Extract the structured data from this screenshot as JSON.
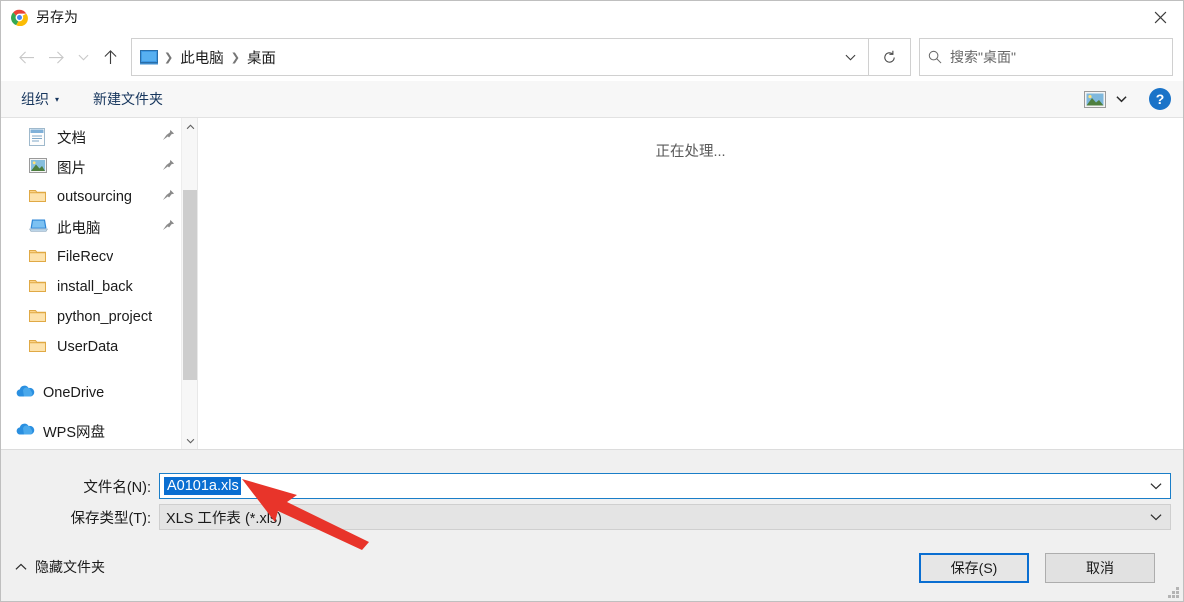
{
  "window": {
    "title": "另存为",
    "app_icon": "chrome-logo-icon",
    "close_label": "✕"
  },
  "nav": {
    "back_icon": "arrow-left-icon",
    "forward_icon": "arrow-right-icon",
    "recent_icon": "chevron-down-icon",
    "up_icon": "arrow-up-icon",
    "breadcrumb": {
      "root_icon": "monitor-icon",
      "items": [
        "此电脑",
        "桌面"
      ],
      "separator": "❯",
      "dropdown_icon": "chevron-down-icon"
    },
    "refresh_icon": "refresh-icon",
    "search": {
      "icon": "search-icon",
      "placeholder": "搜索\"桌面\"",
      "value": ""
    }
  },
  "commandbar": {
    "organize_label": "组织",
    "organize_caret": "▾",
    "new_folder_label": "新建文件夹",
    "view_icon": "picture-view-icon",
    "view_caret": "▾",
    "help_label": "?"
  },
  "sidebar": {
    "items": [
      {
        "label": "文档",
        "icon": "document-icon",
        "pinned": true,
        "pin": "📌"
      },
      {
        "label": "图片",
        "icon": "picture-icon",
        "pinned": true,
        "pin": "📌"
      },
      {
        "label": "outsourcing",
        "icon": "folder-icon",
        "pinned": true,
        "pin": "📌"
      },
      {
        "label": "此电脑",
        "icon": "computer-icon",
        "pinned": true,
        "pin": "📌"
      },
      {
        "label": "FileRecv",
        "icon": "folder-icon",
        "pinned": false
      },
      {
        "label": "install_back",
        "icon": "folder-icon",
        "pinned": false
      },
      {
        "label": "python_project",
        "icon": "folder-icon",
        "pinned": false
      },
      {
        "label": "UserData",
        "icon": "folder-icon",
        "pinned": false
      },
      {
        "label": "OneDrive",
        "icon": "cloud-icon",
        "pinned": false
      },
      {
        "label": "WPS网盘",
        "icon": "cloud-icon",
        "pinned": false
      }
    ],
    "scroll_up_icon": "chevron-up-icon",
    "scroll_down_icon": "chevron-down-icon"
  },
  "filelist": {
    "status_text": "正在处理..."
  },
  "bottom": {
    "filename_label": "文件名(N):",
    "filename_value": "A0101a.xls",
    "filetype_label": "保存类型(T):",
    "filetype_value": "XLS 工作表 (*.xls)",
    "combo_caret": "⌄",
    "hide_folders_label": "隐藏文件夹",
    "hide_folders_icon": "chevron-up-icon",
    "save_label": "保存(S)",
    "cancel_label": "取消",
    "resize_grip_icon": "resize-grip-icon"
  },
  "annotation": {
    "arrow_color": "#e8342a",
    "arrow_icon": "red-arrow-pointer"
  },
  "colors": {
    "accent": "#0a6ed1",
    "selection": "#0a6ed1",
    "command_text": "#17365d",
    "panel_bg": "#f0f0f0",
    "annotation_red": "#e8342a"
  }
}
